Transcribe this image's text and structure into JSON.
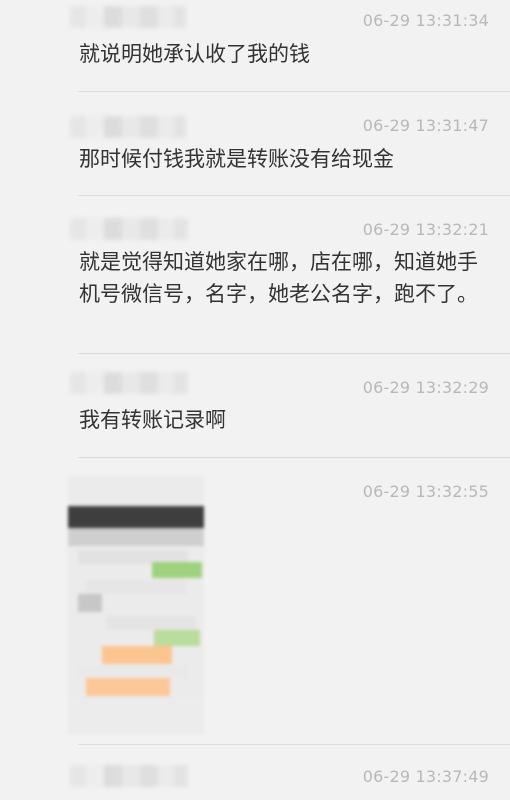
{
  "messages": [
    {
      "time": "06-29 13:31:34",
      "text": "就说明她承认收了我的钱"
    },
    {
      "time": "06-29 13:31:47",
      "text": "那时候付钱我就是转账没有给现金"
    },
    {
      "time": "06-29 13:32:21",
      "text": "就是觉得知道她家在哪，店在哪，知道她手机号微信号，名字，她老公名字，跑不了。"
    },
    {
      "time": "06-29 13:32:29",
      "text": "我有转账记录啊"
    },
    {
      "time": "06-29 13:32:55",
      "text": ""
    },
    {
      "time": "06-29 13:37:49",
      "text": ""
    }
  ],
  "colors": {
    "background": "#f2f2f2",
    "text": "#333333",
    "timestamp": "#b8b8b8",
    "divider": "#dedede"
  }
}
